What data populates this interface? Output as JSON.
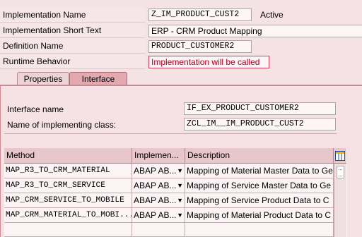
{
  "header": {
    "impl_name_label": "Implementation Name",
    "impl_name_value": "Z_IM_PRODUCT_CUST2",
    "impl_status": "Active",
    "short_text_label": "Implementation Short Text",
    "short_text_value": "ERP - CRM Product Mapping",
    "def_name_label": "Definition Name",
    "def_name_value": "PRODUCT_CUSTOMER2",
    "runtime_label": "Runtime Behavior",
    "runtime_value": "Implementation will be called"
  },
  "tabs": [
    {
      "label": "Properties",
      "active": false
    },
    {
      "label": "Interface",
      "active": true
    }
  ],
  "interface": {
    "name_label": "Interface name",
    "name_value": "IF_EX_PRODUCT_CUSTOMER2",
    "class_label": "Name of implementing class:",
    "class_value": "ZCL_IM__IM_PRODUCT_CUST2"
  },
  "grid": {
    "headers": [
      "Method",
      "Implemen...",
      "Description"
    ],
    "rows": [
      {
        "method": "MAP_R3_TO_CRM_MATERIAL",
        "impl": "ABAP AB...",
        "desc": "Mapping of Material Master Data to Ge"
      },
      {
        "method": "MAP_R3_TO_CRM_SERVICE",
        "impl": "ABAP AB...",
        "desc": "Mapping of Service Master Data to Ge"
      },
      {
        "method": "MAP_CRM_SERVICE_TO_MOBILE",
        "impl": "ABAP AB...",
        "desc": "Mapping of Service Product Data to C"
      },
      {
        "method": "MAP_CRM_MATERIAL_TO_MOBI...",
        "impl": "ABAP AB...",
        "desc": "Mapping of Material Product Data to C"
      }
    ]
  },
  "icons": {
    "layout": "column-layout-icon",
    "dropdown": "triangle-down-icon"
  },
  "colors": {
    "background": "#f4e2e4",
    "header_row": "#e7c7cb",
    "runtime_text": "#b00020",
    "accent_border": "#c98c95"
  }
}
